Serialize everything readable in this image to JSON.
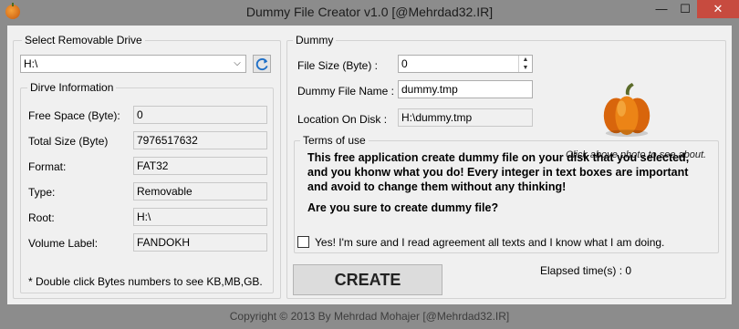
{
  "window": {
    "title": "Dummy File Creator v1.0 [@Mehrdad32.IR]",
    "minimize": "—",
    "maximize": "☐",
    "close": "✕"
  },
  "drive": {
    "legend": "Select Removable Drive",
    "selected": "H:\\",
    "chevron": "⌵",
    "refresh_icon": "refresh-icon"
  },
  "info": {
    "legend": "Dirve Information",
    "fields": [
      {
        "label": "Free Space (Byte):",
        "value": "0"
      },
      {
        "label": "Total Size (Byte)",
        "value": "7976517632"
      },
      {
        "label": "Format:",
        "value": "FAT32"
      },
      {
        "label": "Type:",
        "value": "Removable"
      },
      {
        "label": "Root:",
        "value": "H:\\"
      },
      {
        "label": "Volume Label:",
        "value": "FANDOKH"
      }
    ],
    "note": "* Double click Bytes numbers to see KB,MB,GB."
  },
  "dummy": {
    "legend": "Dummy",
    "file_size_label": "File Size (Byte) :",
    "file_size_value": "0",
    "file_name_label": "Dummy File Name :",
    "file_name_value": "dummy.tmp",
    "location_label": "Location On Disk :",
    "location_value": "H:\\dummy.tmp",
    "about_hint": "Click above photo to see about."
  },
  "terms": {
    "legend": "Terms of use",
    "text": "This free application create dummy file on your disk that you selected, and you khonw what you do! Every integer in text boxes are important and avoid to change them without any thinking!",
    "question": "Are you sure to create dummy file?",
    "agree_label": "Yes! I'm sure and I read agreement all texts and I know what I am doing.",
    "agree_checked": false
  },
  "actions": {
    "create_label": "CREATE",
    "elapsed_label": "Elapsed time(s) : 0"
  },
  "footer": "Copyright ©  2013 By Mehrdad Mohajer [@Mehrdad32.IR]",
  "colors": {
    "frame": "#8c8c8c",
    "client": "#f0f0f0",
    "close": "#c74b3f",
    "pumpkin": "#e0740f"
  }
}
